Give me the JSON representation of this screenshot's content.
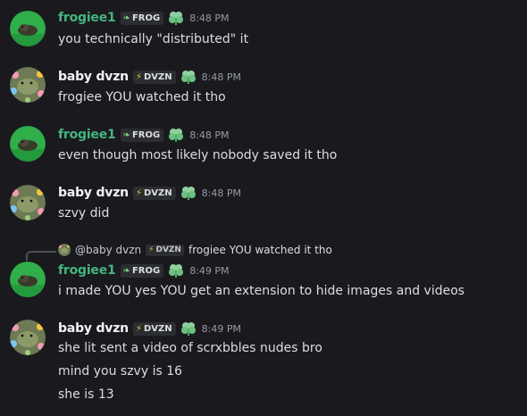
{
  "messages": [
    {
      "user": "frogiee1",
      "tag_icon": "leaf-icon",
      "tag": "FROG",
      "time": "8:48 PM",
      "lines": [
        "you technically \"distributed\" it"
      ]
    },
    {
      "user": "baby dvzn",
      "tag_icon": "bolt-icon",
      "tag": "DVZN",
      "time": "8:48 PM",
      "lines": [
        "frogiee YOU watched it tho"
      ]
    },
    {
      "user": "frogiee1",
      "tag_icon": "leaf-icon",
      "tag": "FROG",
      "time": "8:48 PM",
      "lines": [
        "even though most likely nobody saved it tho"
      ]
    },
    {
      "user": "baby dvzn",
      "tag_icon": "bolt-icon",
      "tag": "DVZN",
      "time": "8:48 PM",
      "lines": [
        "szvy did"
      ]
    },
    {
      "user": "frogiee1",
      "tag_icon": "leaf-icon",
      "tag": "FROG",
      "time": "8:49 PM",
      "lines": [
        "i made YOU yes YOU get an extension to hide images and videos"
      ],
      "reply": {
        "name": "@baby dvzn",
        "tag": "DVZN",
        "text": "frogiee YOU watched it tho"
      }
    },
    {
      "user": "baby dvzn",
      "tag_icon": "bolt-icon",
      "tag": "DVZN",
      "time": "8:49 PM",
      "lines": [
        "she lit sent a video of scrxbbles nudes bro",
        "mind you szvy is 16",
        "she is 13"
      ]
    }
  ],
  "colors": {
    "frog_name": "#43b581",
    "dvzn_name": "#f2f3f5",
    "background": "#1a1a1e",
    "timestamp": "#949ba4"
  }
}
